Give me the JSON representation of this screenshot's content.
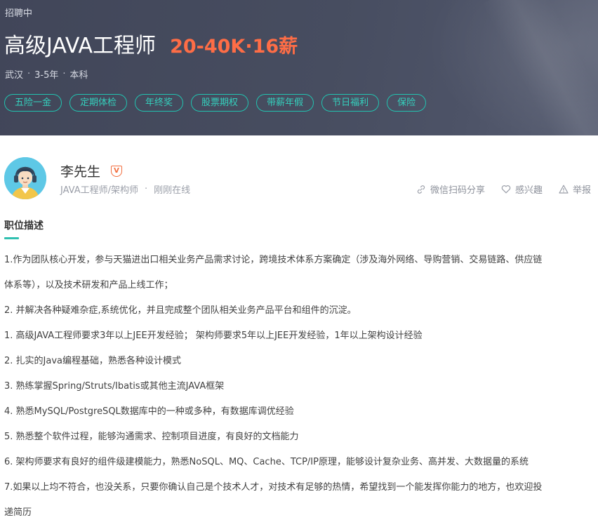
{
  "header": {
    "status": "招聘中",
    "title": "高级JAVA工程师",
    "salary": "20-40K·16薪",
    "location": "武汉",
    "experience": "3-5年",
    "education": "本科",
    "separator": "·",
    "benefits": [
      "五险一金",
      "定期体检",
      "年终奖",
      "股票期权",
      "带薪年假",
      "节日福利",
      "保险"
    ]
  },
  "recruiter": {
    "name": "李先生",
    "badge": "V",
    "role": "JAVA工程师/架构师",
    "separator": "·",
    "online_status": "刚刚在线"
  },
  "actions": {
    "share": "微信扫码分享",
    "interest": "感兴趣",
    "report": "举报"
  },
  "description": {
    "title": "职位描述",
    "lines": [
      "1.作为团队核心开发，参与天猫进出口相关业务产品需求讨论，跨境技术体系方案确定（涉及海外网络、导购营销、交易链路、供应链",
      "体系等），以及技术研发和产品上线工作；",
      "2. 并解决各种疑难杂症,系统优化，并且完成整个团队相关业务产品平台和组件的沉淀。",
      "1. 高级JAVA工程师要求3年以上JEE开发经验； 架构师要求5年以上JEE开发经验，1年以上架构设计经验",
      "2. 扎实的Java编程基础，熟悉各种设计模式",
      "3. 熟练掌握Spring/Struts/Ibatis或其他主流JAVA框架",
      "4. 熟悉MySQL/PostgreSQL数据库中的一种或多种，有数据库调优经验",
      "5. 熟悉整个软件过程，能够沟通需求、控制项目进度，有良好的文档能力",
      "6. 架构师要求有良好的组件级建模能力，熟悉NoSQL、MQ、Cache、TCP/IP原理，能够设计复杂业务、高并发、大数据量的系统",
      "7.如果以上均不符合，也没关系，只要你确认自己是个技术人才，对技术有足够的热情，希望找到一个能发挥你能力的地方，也欢迎投",
      "递简历"
    ]
  },
  "colors": {
    "accent": "#2fc0b0",
    "salary": "#fe6d46",
    "banner": "#464b5e"
  }
}
